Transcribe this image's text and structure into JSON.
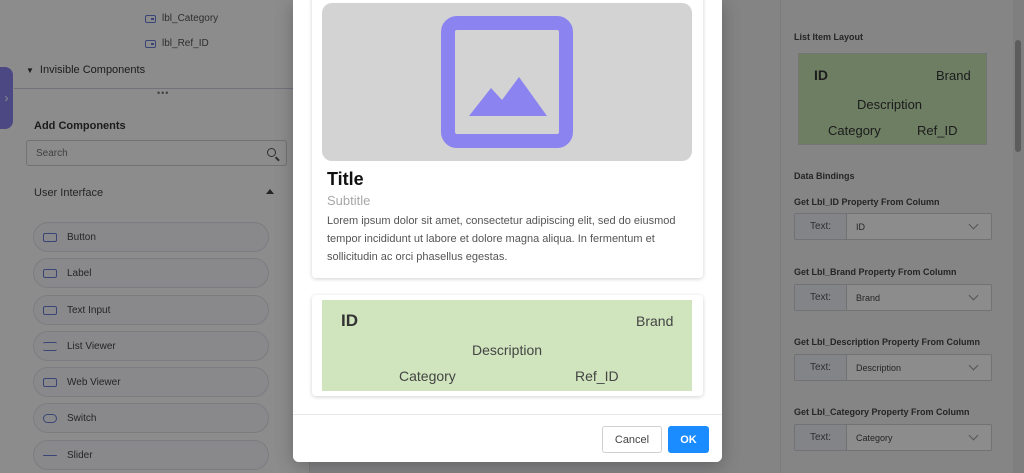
{
  "tree": {
    "items": [
      {
        "label": "lbl_Category"
      },
      {
        "label": "lbl_Ref_ID"
      }
    ],
    "invisible_components_label": "Invisible Components"
  },
  "add_components": {
    "title": "Add Components",
    "search_placeholder": "Search",
    "category_label": "User Interface",
    "items": [
      {
        "label": "Button",
        "icon": "button-icon"
      },
      {
        "label": "Label",
        "icon": "label-icon"
      },
      {
        "label": "Text Input",
        "icon": "text-input-icon"
      },
      {
        "label": "List Viewer",
        "icon": "list-icon"
      },
      {
        "label": "Web Viewer",
        "icon": "web-viewer-icon"
      },
      {
        "label": "Switch",
        "icon": "switch-icon"
      },
      {
        "label": "Slider",
        "icon": "slider-icon"
      }
    ]
  },
  "right_panel": {
    "layout_title": "List Item Layout",
    "layout_preview": {
      "id": "ID",
      "brand": "Brand",
      "description": "Description",
      "category": "Category",
      "ref_id": "Ref_ID"
    },
    "data_bindings_title": "Data Bindings",
    "bindings": [
      {
        "title": "Get Lbl_ID Property From Column",
        "label": "Text:",
        "value": "ID"
      },
      {
        "title": "Get Lbl_Brand Property From Column",
        "label": "Text:",
        "value": "Brand"
      },
      {
        "title": "Get Lbl_Description Property From Column",
        "label": "Text:",
        "value": "Description"
      },
      {
        "title": "Get Lbl_Category Property From Column",
        "label": "Text:",
        "value": "Category"
      }
    ]
  },
  "modal": {
    "card1": {
      "title": "Title",
      "subtitle": "Subtitle",
      "body": "Lorem ipsum dolor sit amet, consectetur adipiscing elit, sed do eiusmod tempor incididunt ut labore et dolore magna aliqua. In fermentum et sollicitudin ac orci phasellus egestas."
    },
    "card2": {
      "id": "ID",
      "brand": "Brand",
      "description": "Description",
      "category": "Category",
      "ref_id": "Ref_ID"
    },
    "cancel_label": "Cancel",
    "ok_label": "OK"
  },
  "colors": {
    "accent": "#8b83f0",
    "primary_button": "#1a8cff",
    "layout_green": "#d0e5bd"
  }
}
